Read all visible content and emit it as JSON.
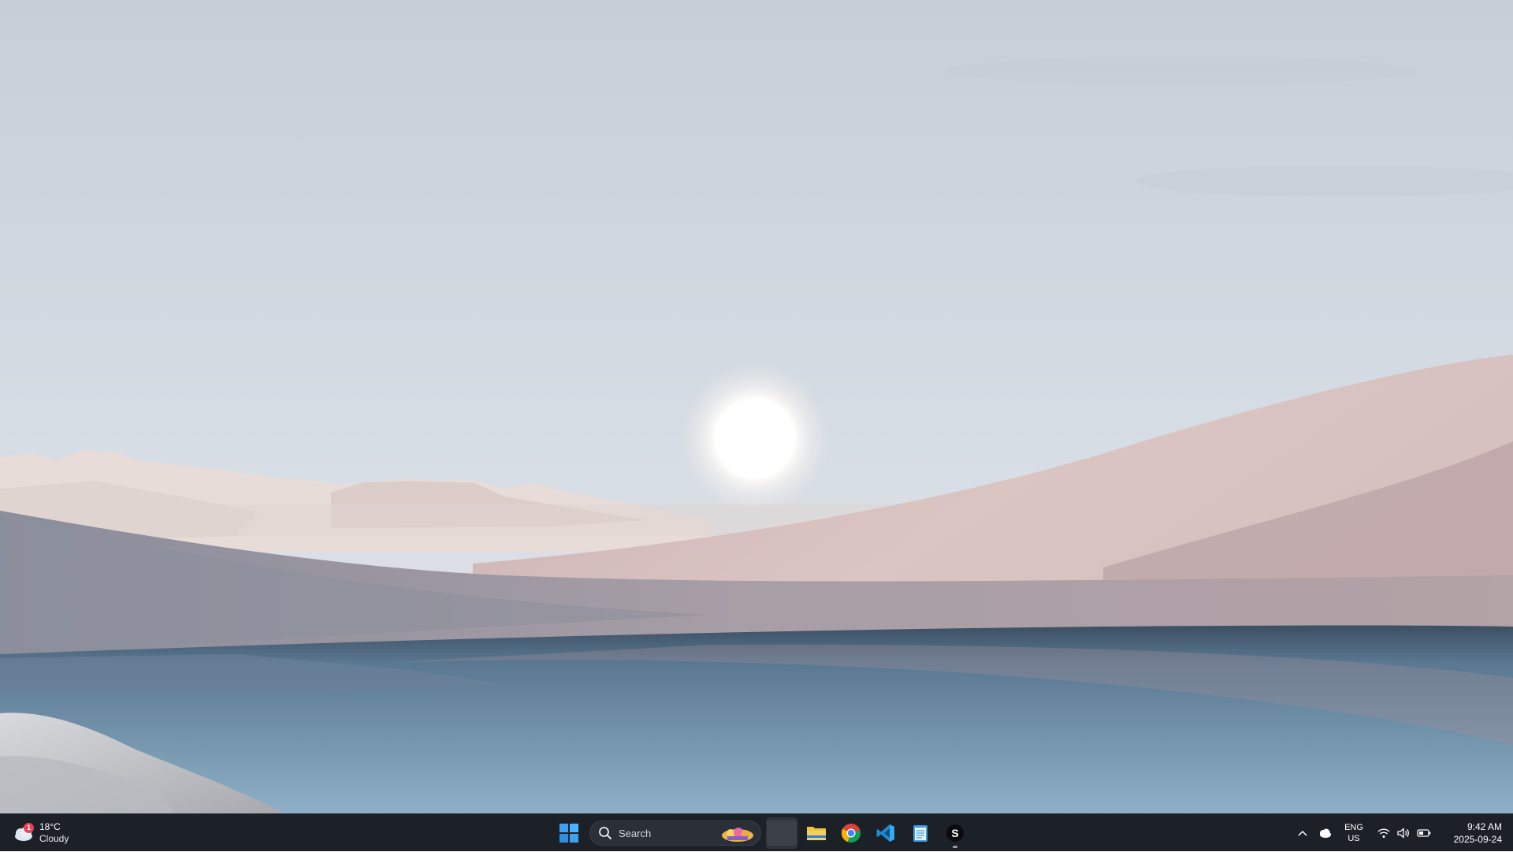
{
  "wallpaper": {
    "description_colors": {
      "sky_top": "#c9d0da",
      "sky_horizon": "#dfe4ea",
      "dune_light": "#d7c3c1",
      "dune_shadow": "#8e8f9d",
      "water": "#7d9cb5",
      "sun": "#ffffff"
    }
  },
  "taskbar": {
    "weather": {
      "temperature": "18°C",
      "condition": "Cloudy",
      "badge": "1"
    },
    "search": {
      "placeholder": "Search"
    },
    "apps": [
      {
        "name": "Start",
        "icon": "windows-icon"
      },
      {
        "name": "Task View",
        "icon": "task-view-thumbnail"
      },
      {
        "name": "File Explorer",
        "icon": "folder-icon"
      },
      {
        "name": "Google Chrome",
        "icon": "chrome-icon"
      },
      {
        "name": "Visual Studio Code",
        "icon": "vscode-icon"
      },
      {
        "name": "Notepad",
        "icon": "notepad-icon"
      },
      {
        "name": "App S",
        "icon": "s-app-icon",
        "label": "S"
      }
    ],
    "tray": {
      "language_line1": "ENG",
      "language_line2": "US",
      "time": "9:42 AM",
      "date": "2025-09-24"
    }
  }
}
